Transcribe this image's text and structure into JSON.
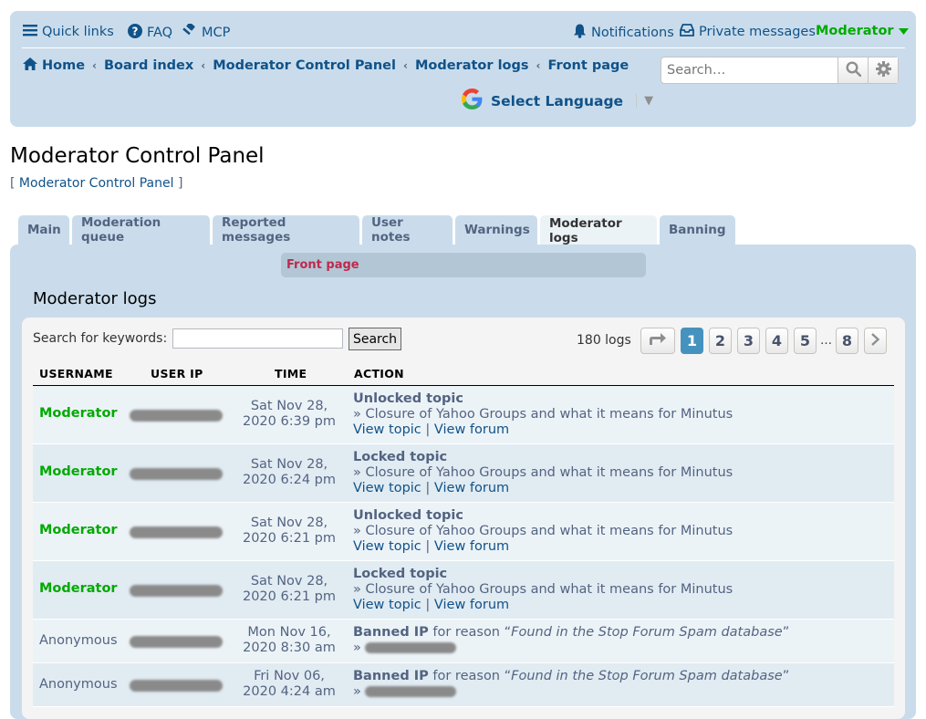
{
  "header": {
    "quick_links": "Quick links",
    "faq": "FAQ",
    "mcp": "MCP",
    "notifications": "Notifications",
    "private_messages": "Private messages",
    "user": "Moderator",
    "breadcrumbs": [
      "Home",
      "Board index",
      "Moderator Control Panel",
      "Moderator logs",
      "Front page"
    ],
    "search_placeholder": "Search…",
    "language": "Select Language"
  },
  "page": {
    "title": "Moderator Control Panel",
    "subtitle": "[ Moderator Control Panel ]",
    "subtitle_link": "Moderator Control Panel"
  },
  "tabs": [
    "Main",
    "Moderation queue",
    "Reported messages",
    "User notes",
    "Warnings",
    "Moderator logs",
    "Banning"
  ],
  "subnav": {
    "active": "Front page"
  },
  "logs": {
    "heading": "Moderator logs",
    "search_label": "Search for keywords:",
    "search_button": "Search",
    "count": "180 logs",
    "pages": [
      "1",
      "2",
      "3",
      "4",
      "5",
      "…",
      "8"
    ],
    "columns": [
      "USERNAME",
      "USER IP",
      "TIME",
      "ACTION"
    ],
    "rows": [
      {
        "user": "Moderator",
        "time1": "Sat Nov 28,",
        "time2": "2020 6:39 pm",
        "action": "Unlocked topic",
        "detail": "» Closure of Yahoo Groups and what it means for Minutus",
        "link1": "View topic",
        "sep": "|",
        "link2": "View forum"
      },
      {
        "user": "Moderator",
        "time1": "Sat Nov 28,",
        "time2": "2020 6:24 pm",
        "action": "Locked topic",
        "detail": "» Closure of Yahoo Groups and what it means for Minutus",
        "link1": "View topic",
        "sep": "|",
        "link2": "View forum"
      },
      {
        "user": "Moderator",
        "time1": "Sat Nov 28,",
        "time2": "2020 6:21 pm",
        "action": "Unlocked topic",
        "detail": "» Closure of Yahoo Groups and what it means for Minutus",
        "link1": "View topic",
        "sep": "|",
        "link2": "View forum"
      },
      {
        "user": "Moderator",
        "time1": "Sat Nov 28,",
        "time2": "2020 6:21 pm",
        "action": "Locked topic",
        "detail": "» Closure of Yahoo Groups and what it means for Minutus",
        "link1": "View topic",
        "sep": "|",
        "link2": "View forum"
      },
      {
        "user": "Anonymous",
        "time1": "Mon Nov 16,",
        "time2": "2020 8:30 am",
        "action": "Banned IP",
        "reason_prefix": "for reason “",
        "reason": "Found in the Stop Forum Spam database",
        "reason_suffix": "”",
        "raquo": "»"
      },
      {
        "user": "Anonymous",
        "time1": "Fri Nov 06,",
        "time2": "2020 4:24 am",
        "action": "Banned IP",
        "reason_prefix": "for reason “",
        "reason": "Found in the Stop Forum Spam database",
        "reason_suffix": "”",
        "raquo": "»"
      }
    ]
  },
  "colors": {
    "header_bg": "#cadceb",
    "link": "#105289",
    "moderator": "#00aa00",
    "active_page": "#4692bf",
    "subnav_active": "#bc2a4d"
  }
}
